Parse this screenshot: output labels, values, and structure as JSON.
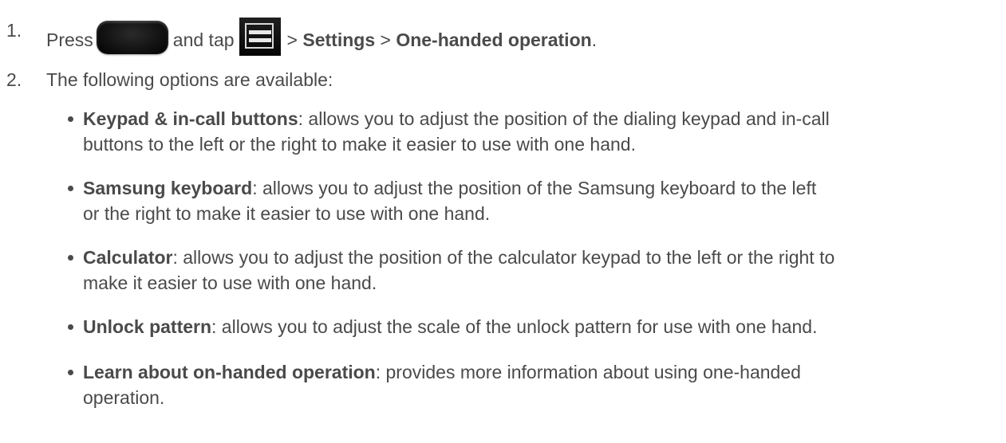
{
  "steps": [
    {
      "number": "1.",
      "press": "Press",
      "home_key_icon": "home-key-icon",
      "and_tap": "and tap",
      "menu_key_icon": "menu-key-icon",
      "sep1": ">",
      "settings": "Settings",
      "sep2": ">",
      "one_handed": "One-handed operation",
      "end": "."
    },
    {
      "number": "2.",
      "text": "The following options are available:"
    }
  ],
  "options": [
    {
      "title": "Keypad & in-call buttons",
      "line1": ": allows you to adjust the position of the dialing keypad and in-call",
      "line2": "buttons to the left or the right to make it easier to use with one hand."
    },
    {
      "title": "Samsung keyboard",
      "line1": ": allows you to adjust the position of the Samsung keyboard to the left",
      "line2": "or the right to make it easier to use with one hand."
    },
    {
      "title": "Calculator",
      "line1": ": allows you to adjust the position of the calculator keypad to the left or the right to",
      "line2": "make it easier to use with one hand."
    },
    {
      "title": "Unlock pattern",
      "line1": ": allows you to adjust the scale of the unlock pattern for use with one hand."
    },
    {
      "title": "Learn about on-handed operation",
      "line1": ": provides more information about using one-handed",
      "line2": "operation."
    }
  ]
}
